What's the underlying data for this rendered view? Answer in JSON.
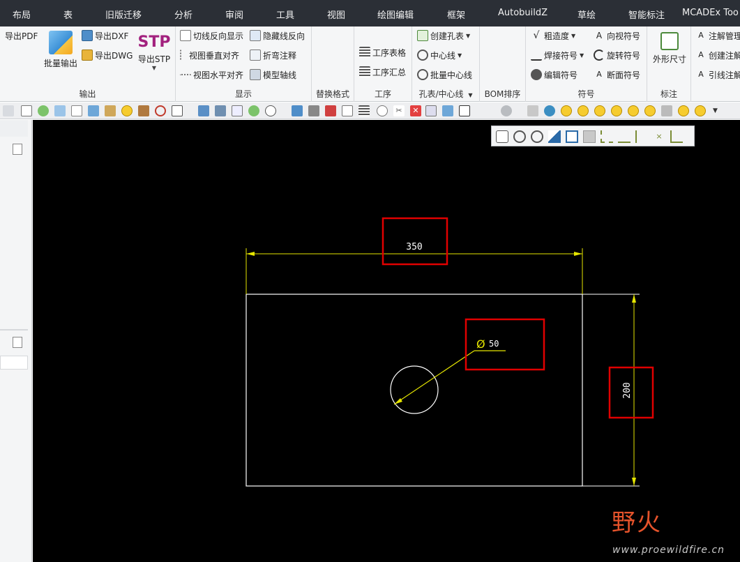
{
  "menu": {
    "items": [
      "布局",
      "表",
      "旧版迁移",
      "分析",
      "审阅",
      "工具",
      "视图",
      "绘图编辑",
      "框架",
      "AutobuildZ",
      "草绘",
      "智能标注",
      "MCADEx Too"
    ]
  },
  "ribbon": {
    "output": {
      "label": "输出",
      "export_pdf": "导出PDF",
      "batch_output": "批量输出",
      "export_dxf": "导出DXF",
      "export_dwg": "导出DWG",
      "export_stp": "导出STP",
      "stp_logo": "STP"
    },
    "display": {
      "label": "显示",
      "cut_reverse": "切线反向显示",
      "hidden_reverse": "隐藏线反向",
      "view_vertical_align": "视图垂直对齐",
      "bend_note": "折弯注释",
      "view_horizontal_align": "视图水平对齐",
      "model_axis": "模型轴线"
    },
    "replace_format": {
      "label": "替换格式"
    },
    "process": {
      "label": "工序",
      "process_table": "工序表格",
      "process_summary": "工序汇总"
    },
    "hole": {
      "label": "孔表/中心线",
      "create_hole_table": "创建孔表",
      "center_line": "中心线",
      "batch_center_line": "批量中心线"
    },
    "bom": {
      "label": "BOM排序"
    },
    "symbol": {
      "label": "符号",
      "roughness": "粗造度",
      "view_direction": "向视符号",
      "weld_symbol": "焊接符号",
      "rotate_symbol": "旋转符号",
      "edit_symbol": "编辑符号",
      "section_symbol": "断面符号"
    },
    "dimension": {
      "label": "标注",
      "outline_size": "外形尺寸"
    },
    "notes": {
      "note_manage": "注解管理",
      "create_note": "创建注解",
      "leader_note": "引线注解"
    }
  },
  "drawing": {
    "dim_width": "350",
    "dim_height": "200",
    "dim_diameter": "50",
    "diameter_symbol": "Ø",
    "colors": {
      "background": "#000000",
      "geometry": "#ffffff",
      "dimension": "#e6e600",
      "highlight": "#e00000"
    }
  },
  "watermark": {
    "logo": "野火",
    "url": "www.proewildfire.cn"
  }
}
